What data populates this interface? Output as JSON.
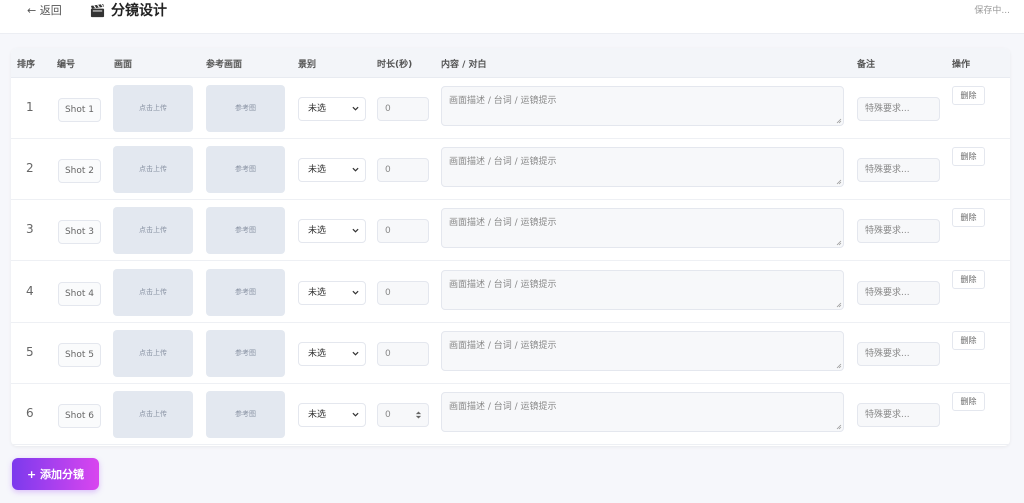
{
  "header": {
    "back_label": "← 返回",
    "title": "分镜设计",
    "save_status": "保存中..."
  },
  "table": {
    "columns": [
      "排序",
      "编号",
      "画面",
      "参考画面",
      "景别",
      "时长(秒)",
      "内容 / 对白",
      "备注",
      "操作"
    ],
    "rows": [
      {
        "seq": "1",
        "code": "Shot 1",
        "upload": "点击上传",
        "ref": "参考图",
        "shot_type": "未选",
        "duration": "0",
        "content_placeholder": "画面描述 / 台词 / 运镜提示",
        "note_placeholder": "特殊要求...",
        "delete": "删除"
      },
      {
        "seq": "2",
        "code": "Shot 2",
        "upload": "点击上传",
        "ref": "参考图",
        "shot_type": "未选",
        "duration": "0",
        "content_placeholder": "画面描述 / 台词 / 运镜提示",
        "note_placeholder": "特殊要求...",
        "delete": "删除"
      },
      {
        "seq": "3",
        "code": "Shot 3",
        "upload": "点击上传",
        "ref": "参考图",
        "shot_type": "未选",
        "duration": "0",
        "content_placeholder": "画面描述 / 台词 / 运镜提示",
        "note_placeholder": "特殊要求...",
        "delete": "删除"
      },
      {
        "seq": "4",
        "code": "Shot 4",
        "upload": "点击上传",
        "ref": "参考图",
        "shot_type": "未选",
        "duration": "0",
        "content_placeholder": "画面描述 / 台词 / 运镜提示",
        "note_placeholder": "特殊要求...",
        "delete": "删除"
      },
      {
        "seq": "5",
        "code": "Shot 5",
        "upload": "点击上传",
        "ref": "参考图",
        "shot_type": "未选",
        "duration": "0",
        "content_placeholder": "画面描述 / 台词 / 运镜提示",
        "note_placeholder": "特殊要求...",
        "delete": "删除"
      },
      {
        "seq": "6",
        "code": "Shot 6",
        "upload": "点击上传",
        "ref": "参考图",
        "shot_type": "未选",
        "duration": "0",
        "content_placeholder": "画面描述 / 台词 / 运镜提示",
        "note_placeholder": "特殊要求...",
        "delete": "删除"
      }
    ]
  },
  "add_button": {
    "label": "+ 添加分镜"
  },
  "colors": {
    "accent_start": "#7c3aed",
    "accent_end": "#d946ef",
    "upload_bg": "#e3e8f0",
    "page_bg": "#f6f7fb"
  },
  "icons": [
    "clapperboard-icon",
    "chevron-down-icon",
    "spinner-arrows-icon",
    "resize-handle-icon"
  ]
}
